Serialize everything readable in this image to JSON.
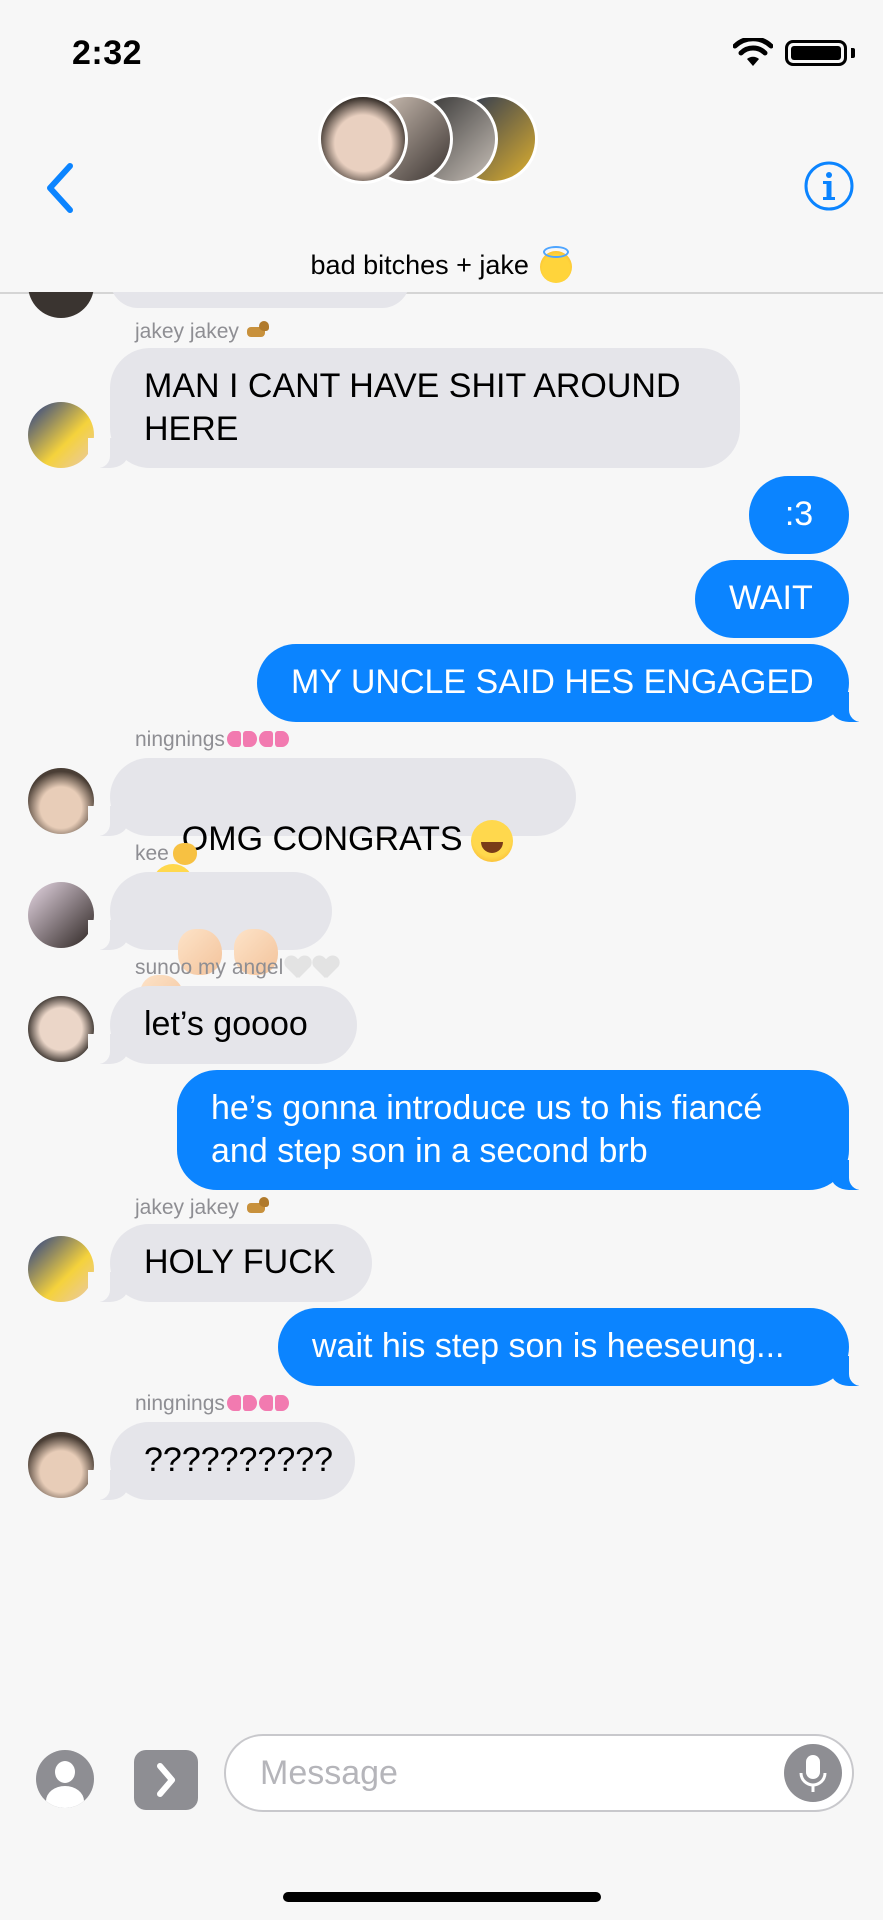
{
  "status_bar": {
    "time": "2:32",
    "wifi_icon": "wifi-icon",
    "battery_icon": "battery-icon"
  },
  "header": {
    "back_icon": "chevron-left-icon",
    "info_icon": "info-icon",
    "title": "bad bitches + jake",
    "title_emoji": "smiling-face-with-halo",
    "accent_color": "#0b84ff"
  },
  "messages": [
    {
      "sender": "jakey jakey",
      "sender_emoji": "dog",
      "text": "MAN I CANT HAVE SHIT AROUND\nHERE",
      "direction": "incoming"
    },
    {
      "text": ":3",
      "direction": "outgoing"
    },
    {
      "text": "WAIT",
      "direction": "outgoing"
    },
    {
      "text": "MY UNCLE SAID HES ENGAGED",
      "direction": "outgoing"
    },
    {
      "sender": "ningnings",
      "sender_emoji": "ribbon ribbon",
      "text": "OMG CONGRATS",
      "text_emoji": "grinning-squinting-face x2",
      "direction": "incoming"
    },
    {
      "sender": "kee",
      "sender_emoji": "cat",
      "text": "",
      "text_emoji": "clapping-hands x3",
      "direction": "incoming"
    },
    {
      "sender": "sunoo my angel",
      "sender_emoji": "white-heart white-heart",
      "text": "let’s goooo",
      "direction": "incoming"
    },
    {
      "text": "he’s gonna introduce us to his fiancé\nand step son in a second brb",
      "direction": "outgoing"
    },
    {
      "sender": "jakey jakey",
      "sender_emoji": "dog",
      "text": "HOLY FUCK",
      "direction": "incoming"
    },
    {
      "text": "wait his step son is heeseung...",
      "direction": "outgoing"
    },
    {
      "sender": "ningnings",
      "sender_emoji": "ribbon ribbon",
      "text": "??????????",
      "direction": "incoming"
    }
  ],
  "composer": {
    "placeholder": "Message",
    "contact_icon": "person-icon",
    "apps_icon": "chevron-right-icon",
    "mic_icon": "microphone-icon"
  },
  "colors": {
    "incoming_bubble": "#e5e5ea",
    "outgoing_bubble": "#0b84ff",
    "background": "#f7f7f7",
    "sender_label": "#8e8e93"
  }
}
